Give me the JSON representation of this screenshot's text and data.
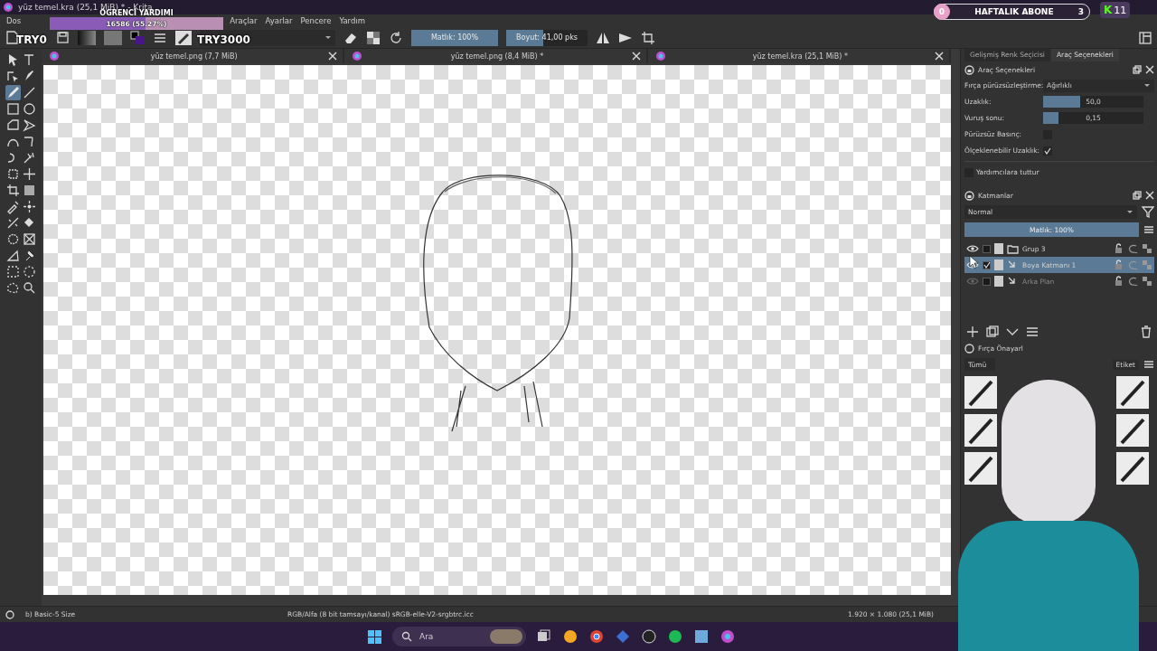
{
  "window": {
    "title": "yüz temel.kra (25,1 MiB) * - Krita"
  },
  "stream_overlays": {
    "goal": {
      "title": "ÖGRENCİ YARDIMI",
      "progress": "16586 (55.27%)",
      "level": 0.55
    },
    "left_count": "TRY0",
    "right_count": "TRY3000",
    "subs": {
      "current": "0",
      "label": "HAFTALIK ABONE",
      "target": "3"
    },
    "badge": {
      "letter": "K",
      "count": "11"
    }
  },
  "menu": [
    "Dos",
    "Araçlar",
    "Ayarlar",
    "Pencere",
    "Yardım"
  ],
  "toolbar": {
    "opacity": {
      "label": "Matlık: 100%",
      "level": 1
    },
    "size": {
      "label": "Boyut: 41,00 pks",
      "level": 0.45
    }
  },
  "toolbox": [
    {
      "selected": false
    },
    {
      "selected": false
    },
    {
      "selected": false
    },
    {
      "selected": false
    },
    {
      "selected": true
    },
    {
      "selected": false
    },
    {
      "selected": false
    },
    {
      "selected": false
    },
    {
      "selected": false
    },
    {
      "selected": false
    },
    {
      "selected": false
    },
    {
      "selected": false
    },
    {
      "selected": false
    },
    {
      "selected": false
    },
    {
      "selected": false
    },
    {
      "selected": false
    },
    {
      "selected": false
    },
    {
      "selected": false
    },
    {
      "selected": false
    },
    {
      "selected": false
    },
    {
      "selected": false
    },
    {
      "selected": false
    },
    {
      "selected": false
    },
    {
      "selected": false
    },
    {
      "selected": false
    },
    {
      "selected": false
    },
    {
      "selected": false
    },
    {
      "selected": false
    },
    {
      "selected": false
    },
    {
      "selected": false
    }
  ],
  "documents": [
    {
      "title": "yüz temel.png (7,7 MiB)"
    },
    {
      "title": "yüz temel.png (8,4 MiB) *"
    },
    {
      "title": "yüz temel.kra (25,1 MiB) *"
    }
  ],
  "dock_tabs": [
    {
      "label": "Gelişmiş Renk Seçicisi",
      "selected": false
    },
    {
      "label": "Araç Seçenekleri",
      "selected": true
    }
  ],
  "tool_options": {
    "title": "Araç Seçenekleri",
    "rows": [
      {
        "kind": "dropdown",
        "label": "Fırça pürüzsüzleştirme:",
        "value": "Ağırlıklı"
      },
      {
        "kind": "slider",
        "label": "Uzaklık:",
        "value": "50,0",
        "level": 0.37
      },
      {
        "kind": "slider",
        "label": "Vuruş sonu:",
        "value": "0,15",
        "level": 0.15
      },
      {
        "kind": "checkbox",
        "label": "Pürüzsüz Basınç:",
        "checked": false
      },
      {
        "kind": "checkbox",
        "label": "Ölçeklenebilir Uzaklık:",
        "checked": true
      },
      {
        "kind": "leftcheck",
        "label": "Yardımcılara tuttur",
        "checked": false
      }
    ]
  },
  "layers": {
    "title": "Katmanlar",
    "blend": "Normal",
    "opacity": {
      "label": "Matlık: 100%",
      "level": 1
    },
    "items": [
      {
        "name": "Grup 3",
        "kind": "group",
        "selected": false,
        "checked": false,
        "visible": true
      },
      {
        "name": "Boya Katmanı 1",
        "kind": "paint",
        "selected": true,
        "checked": true,
        "visible": true
      },
      {
        "name": "Arka Plan",
        "kind": "paint",
        "selected": false,
        "checked": false,
        "visible": false
      }
    ]
  },
  "brush_presets": {
    "title": "Fırça Önayarl",
    "filter": "Tümü",
    "tag": "Etiket"
  },
  "status_bar": {
    "brush": "b) Basic-5 Size",
    "color_space": "RGB/Alfa (8 bit tamsayı/kanal) sRGB-elle-V2-srgbtrc.icc",
    "image_size": "1.920 × 1.080 (25,1 MiB)"
  },
  "taskbar": {
    "search": "Ara"
  }
}
